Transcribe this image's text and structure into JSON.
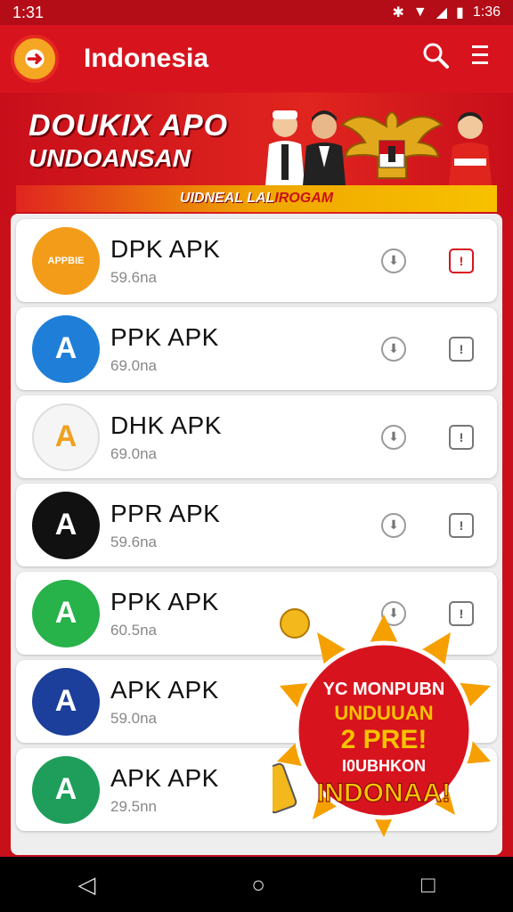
{
  "status_bar": {
    "time": "1:31",
    "clock_right": "1:36",
    "icons": [
      "bluetooth-icon",
      "wifi-icon",
      "signal-icon",
      "battery-icon"
    ]
  },
  "app_bar": {
    "title": "Indonesia",
    "search_icon": "search-icon",
    "menu_icon": "menu-icon"
  },
  "banner": {
    "line1": "DOUKIX APO",
    "line2": "UNDOANSAN",
    "ribbon_a": "UIDNEAL LAL ",
    "ribbon_b": "IROGAM"
  },
  "apps": [
    {
      "name": "DPK APK",
      "size": "59.6na",
      "icon_color": "#f39c1a",
      "icon_text": "APPBIE",
      "opt_red": true
    },
    {
      "name": "PPK APK",
      "size": "69.0na",
      "icon_color": "#1f7fd8",
      "icon_text": "A",
      "opt_red": false
    },
    {
      "name": "DHK APK",
      "size": "69.0na",
      "icon_color": "#f5f5f5",
      "icon_text": "A",
      "opt_red": false
    },
    {
      "name": "PPR APK",
      "size": "59.6na",
      "icon_color": "#111111",
      "icon_text": "A",
      "opt_red": false
    },
    {
      "name": "PPK APK",
      "size": "60.5na",
      "icon_color": "#27b24a",
      "icon_text": "A",
      "opt_red": false
    },
    {
      "name": "APK APK",
      "size": "59.0na",
      "icon_color": "#1b3f9a",
      "icon_text": "A",
      "opt_red": false
    },
    {
      "name": "APK APK",
      "size": "29.5nn",
      "icon_color": "#1e9e5a",
      "icon_text": "A",
      "opt_red": false
    }
  ],
  "promo": {
    "line1": "YC MONPUBN",
    "line2": "UNDUUAN",
    "line3": "2 PRE!",
    "line4": "I0UBHKON",
    "line5": "INDONAA!"
  },
  "nav": {
    "back": "◁",
    "home": "○",
    "recents": "□"
  },
  "colors": {
    "primary": "#d7141e",
    "accent": "#f7c200"
  }
}
